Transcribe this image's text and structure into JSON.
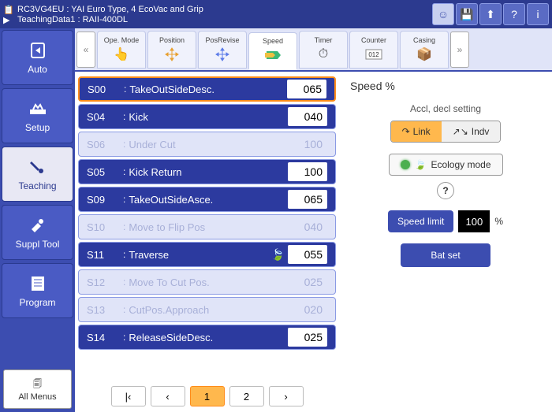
{
  "header": {
    "line1_id": "RC3VG4EU",
    "line1_desc": "YAI Euro Type, 4 EcoVac and Grip",
    "line2_id": "TeachingData1",
    "line2_desc": "RAII-400DL"
  },
  "sidebar": {
    "items": [
      {
        "label": "Auto",
        "icon": "auto"
      },
      {
        "label": "Setup",
        "icon": "setup"
      },
      {
        "label": "Teaching",
        "icon": "teaching"
      },
      {
        "label": "Suppl Tool",
        "icon": "tool"
      },
      {
        "label": "Program",
        "icon": "program"
      }
    ],
    "all_menus": "All Menus"
  },
  "tabs": {
    "items": [
      {
        "label": "Ope. Mode"
      },
      {
        "label": "Position"
      },
      {
        "label": "PosRevise"
      },
      {
        "label": "Speed"
      },
      {
        "label": "Timer"
      },
      {
        "label": "Counter"
      },
      {
        "label": "Casing"
      }
    ]
  },
  "steps": [
    {
      "code": "S00",
      "name": "TakeOutSideDesc.",
      "val": "065",
      "dark": true,
      "selected": true,
      "eco": false
    },
    {
      "code": "S04",
      "name": "Kick",
      "val": "040",
      "dark": true,
      "selected": false,
      "eco": false
    },
    {
      "code": "S06",
      "name": "Under Cut",
      "val": "100",
      "dark": false,
      "selected": false,
      "eco": false
    },
    {
      "code": "S05",
      "name": "Kick Return",
      "val": "100",
      "dark": true,
      "selected": false,
      "eco": false
    },
    {
      "code": "S09",
      "name": "TakeOutSideAsce.",
      "val": "065",
      "dark": true,
      "selected": false,
      "eco": false
    },
    {
      "code": "S10",
      "name": "Move to Flip Pos",
      "val": "040",
      "dark": false,
      "selected": false,
      "eco": false
    },
    {
      "code": "S11",
      "name": "Traverse",
      "val": "055",
      "dark": true,
      "selected": false,
      "eco": true
    },
    {
      "code": "S12",
      "name": "Move To Cut Pos.",
      "val": "025",
      "dark": false,
      "selected": false,
      "eco": false
    },
    {
      "code": "S13",
      "name": "CutPos.Approach",
      "val": "020",
      "dark": false,
      "selected": false,
      "eco": false
    },
    {
      "code": "S14",
      "name": "ReleaseSideDesc.",
      "val": "025",
      "dark": true,
      "selected": false,
      "eco": false
    }
  ],
  "pager": {
    "pages": [
      "1",
      "2"
    ],
    "active": 0
  },
  "right": {
    "title": "Speed %",
    "accl_label": "Accl, decl setting",
    "link": "Link",
    "indv": "Indv",
    "eco": "Ecology mode",
    "help": "?",
    "speed_limit_btn": "Speed limit",
    "speed_limit_val": "100",
    "speed_limit_unit": "%",
    "batset": "Bat set"
  }
}
